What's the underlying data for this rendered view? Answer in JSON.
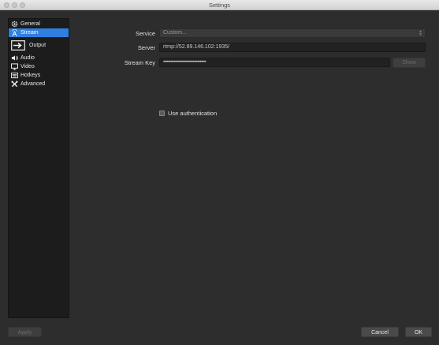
{
  "window": {
    "title": "Settings"
  },
  "sidebar": {
    "items": [
      {
        "label": "General",
        "icon": "gear-icon"
      },
      {
        "label": "Stream",
        "icon": "antenna-icon",
        "active": true
      },
      {
        "label": "Output",
        "icon": "output-icon"
      },
      {
        "label": "Audio",
        "icon": "speaker-icon"
      },
      {
        "label": "Video",
        "icon": "monitor-icon"
      },
      {
        "label": "Hotkeys",
        "icon": "keyboard-icon"
      },
      {
        "label": "Advanced",
        "icon": "tools-icon"
      }
    ]
  },
  "stream": {
    "service_label": "Service",
    "service_value": "Custom...",
    "server_label": "Server",
    "server_value": "rtmp://52.89.146.102:1935/",
    "key_label": "Stream Key",
    "key_value": "••••••••••••••••••••••••••••••••••••",
    "show_label": "Show",
    "auth_label": "Use authentication",
    "auth_checked": false
  },
  "footer": {
    "apply_label": "Apply",
    "cancel_label": "Cancel",
    "ok_label": "OK"
  },
  "colors": {
    "accent": "#2f7fe0",
    "background": "#2d2d2d",
    "sidebar": "#1c1c1c"
  }
}
